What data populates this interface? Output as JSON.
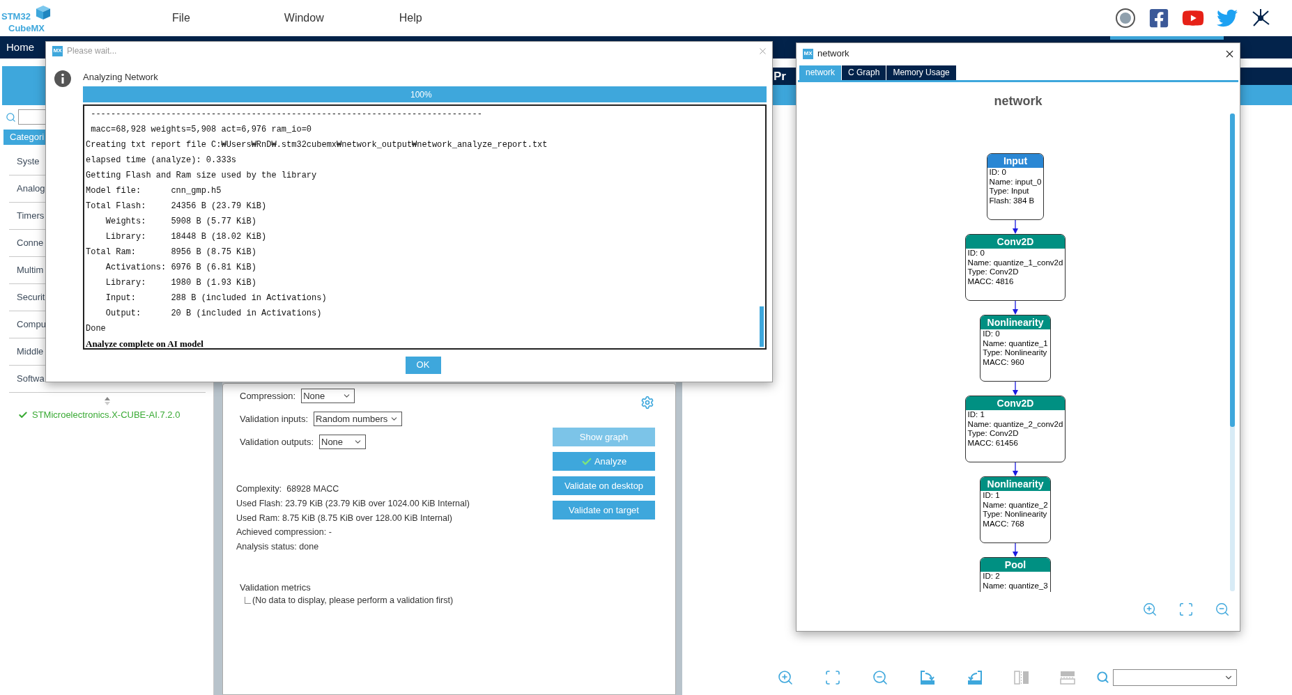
{
  "app": {
    "logo": {
      "top": "STM32",
      "bottom": "CubeMX"
    },
    "menu": [
      {
        "label": "File"
      },
      {
        "label": "Window"
      },
      {
        "label": "Help"
      }
    ],
    "nav": {
      "home": "Home"
    }
  },
  "left_panel": {
    "categories_tab": "Categori",
    "categories": [
      "Syste",
      "Analog",
      "Timers",
      "Conne",
      "Multim",
      "Securit",
      "Compu",
      "Middle",
      "Softwa"
    ],
    "package": {
      "label": "STMicroelectronics.X-CUBE-AI.7.2.0",
      "checked": true
    }
  },
  "model_panel": {
    "fields": [
      {
        "label": "Compression:",
        "value": "None"
      },
      {
        "label": "Validation inputs:",
        "value": "Random numbers"
      },
      {
        "label": "Validation outputs:",
        "value": "None"
      }
    ],
    "buttons": [
      {
        "label": "Show graph",
        "disabled": true,
        "checked": false
      },
      {
        "label": "Analyze",
        "disabled": false,
        "checked": true
      },
      {
        "label": "Validate on desktop",
        "disabled": false,
        "checked": false
      },
      {
        "label": "Validate on target",
        "disabled": false,
        "checked": false
      }
    ],
    "stats": [
      "Complexity:  68928 MACC",
      "Used Flash: 23.79 KiB (23.79 KiB over 1024.00 KiB Internal)",
      "Used Ram: 8.75 KiB (8.75 KiB over 128.00 KiB Internal)",
      "Achieved compression: -",
      "Analysis status: done"
    ],
    "validation": {
      "title": "Validation metrics",
      "children": [
        {
          "label": "(No data to display, please perform a validation first)"
        }
      ]
    }
  },
  "project_header": {
    "title": "Pr"
  },
  "dialog": {
    "icon": "MX",
    "title": "Please wait...",
    "message": "Analyzing Network",
    "progress": {
      "level": 1,
      "reading": "100%"
    },
    "log": [
      {
        "kind": "plain",
        "text": " ------------------------------------------------------------------------------"
      },
      {
        "kind": "plain",
        "text": " macc=68,928 weights=5,908 act=6,976 ram_io=0"
      },
      {
        "kind": "plain",
        "text": "Creating txt report file C:₩Users₩RnD₩.stm32cubemx₩network_output₩network_analyze_report.txt"
      },
      {
        "kind": "plain",
        "text": "elapsed time (analyze): 0.333s"
      },
      {
        "kind": "plain",
        "text": "Getting Flash and Ram size used by the library"
      },
      {
        "kind": "plain",
        "text": "Model file:      cnn_gmp.h5"
      },
      {
        "kind": "plain",
        "text": "Total Flash:     24356 B (23.79 KiB)"
      },
      {
        "kind": "plain",
        "text": "    Weights:     5908 B (5.77 KiB)"
      },
      {
        "kind": "plain",
        "text": "    Library:     18448 B (18.02 KiB)"
      },
      {
        "kind": "plain",
        "text": "Total Ram:       8956 B (8.75 KiB)"
      },
      {
        "kind": "plain",
        "text": "    Activations: 6976 B (6.81 KiB)"
      },
      {
        "kind": "plain",
        "text": "    Library:     1980 B (1.93 KiB)"
      },
      {
        "kind": "plain",
        "text": "    Input:       288 B (included in Activations)"
      },
      {
        "kind": "plain",
        "text": "    Output:      20 B (included in Activations)"
      },
      {
        "kind": "plain",
        "text": "Done"
      },
      {
        "kind": "bold",
        "text": "Analyze complete on AI model"
      }
    ],
    "ok": "OK"
  },
  "network_window": {
    "icon": "MX",
    "title": "network",
    "tabs": [
      {
        "label": "network",
        "selected": true
      },
      {
        "label": "C Graph",
        "selected": false
      },
      {
        "label": "Memory Usage",
        "selected": false
      }
    ],
    "heading": "network",
    "nodes": [
      {
        "kind": "input",
        "title": "Input",
        "lines": [
          "ID: 0",
          "Name: input_0",
          "Type: Input",
          "Flash: 384 B"
        ]
      },
      {
        "kind": "layer",
        "title": "Conv2D",
        "lines": [
          "ID: 0",
          "Name: quantize_1_conv2d",
          "Type: Conv2D",
          "MACC: 4816"
        ]
      },
      {
        "kind": "layer",
        "title": "Nonlinearity",
        "lines": [
          "ID: 0",
          "Name: quantize_1",
          "Type: Nonlinearity",
          "MACC: 960"
        ]
      },
      {
        "kind": "layer",
        "title": "Conv2D",
        "lines": [
          "ID: 1",
          "Name: quantize_2_conv2d",
          "Type: Conv2D",
          "MACC: 61456"
        ]
      },
      {
        "kind": "layer",
        "title": "Nonlinearity",
        "lines": [
          "ID: 1",
          "Name: quantize_2",
          "Type: Nonlinearity",
          "MACC: 768"
        ]
      },
      {
        "kind": "layer",
        "title": "Pool",
        "lines": [
          "ID: 2",
          "Name: quantize_3"
        ]
      }
    ]
  }
}
